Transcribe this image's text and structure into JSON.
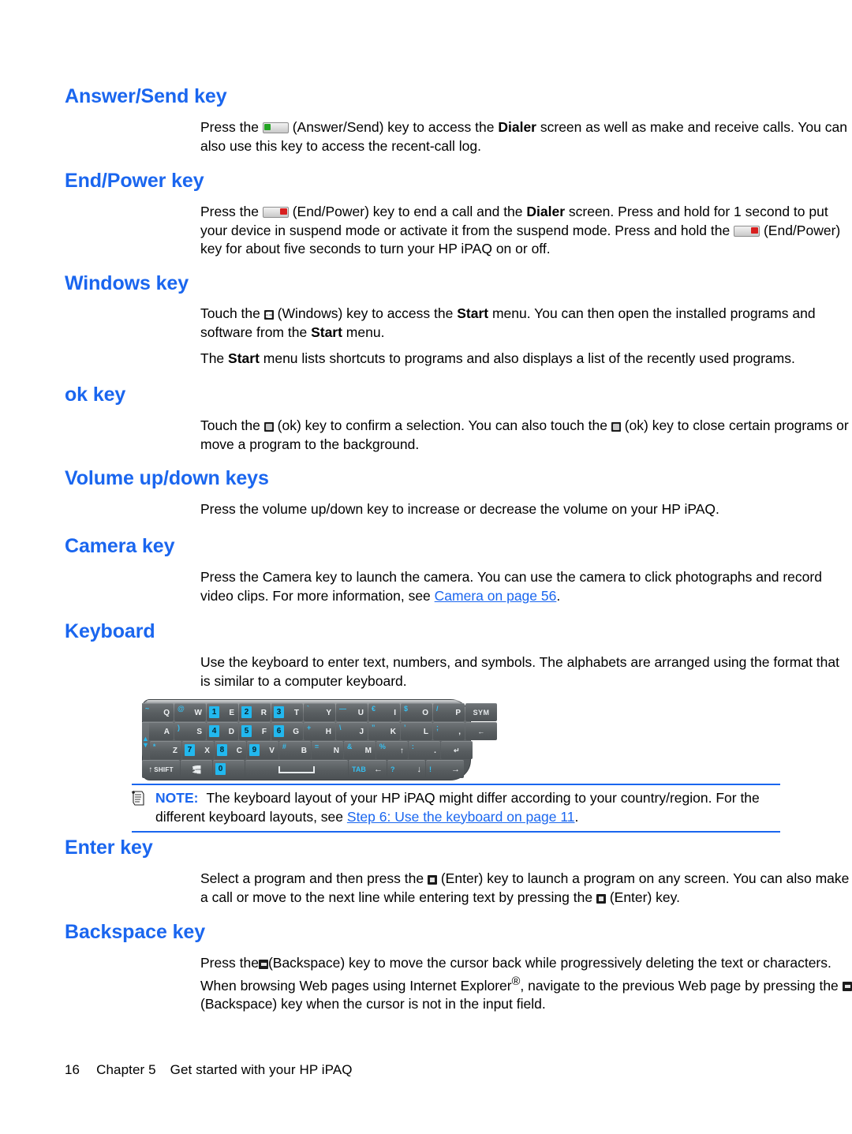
{
  "document": {
    "accent_color": "#1a66ef",
    "link_color": "#1a66ef"
  },
  "sections": [
    {
      "id": "answer-send-key",
      "heading": "Answer/Send key",
      "paragraphs": [
        {
          "lead": "Press the",
          "icon": "answer-send-key-icon",
          "text_a": "(Answer/Send) key to access the ",
          "bold_a": "Dialer",
          "text_b": " screen as well as make and receive calls. You can also use this key to access the recent-call log."
        }
      ]
    },
    {
      "id": "end-power-key",
      "heading": "End/Power key",
      "paragraphs": [
        {
          "lead": "Press the",
          "icon": "end-power-key-icon",
          "text_a": "(End/Power) key to end a call and the ",
          "bold_a": "Dialer",
          "text_b": " screen. Press and hold for 1 second to put your device in suspend mode or activate it from the suspend mode. Press and hold the",
          "icon_b": "end-power-key-icon",
          "text_c": "(End/Power) key for about five seconds to turn your HP iPAQ on or off."
        }
      ]
    },
    {
      "id": "windows-key",
      "heading": "Windows key",
      "paragraphs": [
        {
          "lead": "Touch the",
          "icon": "windows-key-icon",
          "text_a": "(Windows) key to access the ",
          "bold_a": "Start",
          "text_b": " menu. You can then open the installed programs and software from the ",
          "bold_b": "Start",
          "text_c": " menu."
        },
        {
          "lead_plain_a": "The ",
          "bold_a": "Start",
          "text_a": " menu lists shortcuts to programs and also displays a list of the recently used programs."
        }
      ]
    },
    {
      "id": "ok-key",
      "heading": "ok key",
      "paragraphs": [
        {
          "lead": "Touch the",
          "icon": "ok-key-icon",
          "text_a": "(ok) key to confirm a selection. You can also touch the",
          "icon_b": "ok-key-icon",
          "text_b": "(ok) key to close certain programs or move a program to the background."
        }
      ]
    },
    {
      "id": "volume-up-down-keys",
      "heading": "Volume up/down keys",
      "paragraphs": [
        {
          "text_plain": "Press the volume up/down key to increase or decrease the volume on your HP iPAQ."
        }
      ]
    },
    {
      "id": "camera-key",
      "heading": "Camera key",
      "paragraphs": [
        {
          "text_a": "Press the Camera key to launch the camera. You can use the camera to click photographs and record video clips. For more information, see ",
          "link": "Camera on page 56",
          "text_b": "."
        }
      ]
    },
    {
      "id": "keyboard",
      "heading": "Keyboard",
      "paragraphs": [
        {
          "text_plain": "Use the keyboard to enter text, numbers, and symbols. The alphabets are arranged using the format that is similar to a computer keyboard."
        }
      ]
    },
    {
      "id": "enter-key",
      "heading": "Enter key",
      "paragraphs": [
        {
          "lead": "Select a program and then press the",
          "icon": "enter-key-icon",
          "text_a": "(Enter) key to launch a program on any screen. You can also make a call or move to the next line while entering text by pressing the",
          "icon_b": "enter-key-icon",
          "text_b": "(Enter) key."
        }
      ]
    },
    {
      "id": "backspace-key",
      "heading": "Backspace key",
      "paragraphs": [
        {
          "lead": "Press the",
          "icon": "backspace-key-icon",
          "text_a": "(Backspace) key to move the cursor back while progressively deleting the text or characters. When browsing Web pages using Internet Explorer",
          "sup": "®",
          "text_b": ", navigate to the previous Web page by pressing the",
          "icon_b": "backspace-key-icon",
          "text_c": "(Backspace) key when the cursor is not in the input field."
        }
      ]
    }
  ],
  "note": {
    "icon": "note-icon",
    "label": "NOTE:",
    "text_a": "The keyboard layout of your HP iPAQ might differ according to your country/region. For the different keyboard layouts, see ",
    "link": "Step 6: Use the keyboard on page 11",
    "text_b": "."
  },
  "keyboard_figure": {
    "name": "hp-ipaq-qwerty-keyboard-diagram",
    "rows": [
      {
        "keys": [
          {
            "type": "letter",
            "sub": "~",
            "main": "Q",
            "clipped": true
          },
          {
            "type": "letter",
            "sub": "@",
            "main": "W"
          },
          {
            "type": "numkey",
            "num": "1",
            "main": "E"
          },
          {
            "type": "numkey",
            "num": "2",
            "main": "R"
          },
          {
            "type": "numkey",
            "num": "3",
            "main": "T"
          },
          {
            "type": "letter",
            "sub": "`",
            "main": "Y"
          },
          {
            "type": "letter",
            "sub": "—",
            "main": "U"
          },
          {
            "type": "letter",
            "sub": "€",
            "main": "I"
          },
          {
            "type": "letter",
            "sub": "$",
            "main": "O"
          },
          {
            "type": "letter",
            "sub": "/",
            "main": "P"
          },
          {
            "type": "special",
            "main": "SYM"
          }
        ]
      },
      {
        "keys": [
          {
            "type": "letter",
            "sub": "(",
            "main": "A",
            "clipped": true
          },
          {
            "type": "letter",
            "sub": ")",
            "main": "S"
          },
          {
            "type": "numkey",
            "num": "4",
            "main": "D"
          },
          {
            "type": "numkey",
            "num": "5",
            "main": "F"
          },
          {
            "type": "numkey",
            "num": "6",
            "main": "G"
          },
          {
            "type": "letter",
            "sub": "+",
            "main": "H"
          },
          {
            "type": "letter",
            "sub": "\\",
            "main": "J"
          },
          {
            "type": "letter",
            "sub": "”",
            "main": "K"
          },
          {
            "type": "letter",
            "sub": "’",
            "main": "L"
          },
          {
            "type": "letter",
            "sub": ";",
            "main": ","
          },
          {
            "type": "special",
            "main": "←"
          }
        ]
      },
      {
        "keys": [
          {
            "type": "nav",
            "main": "▲▼"
          },
          {
            "type": "letter",
            "sub": "*",
            "main": "Z"
          },
          {
            "type": "numkey",
            "num": "7",
            "main": "X"
          },
          {
            "type": "numkey",
            "num": "8",
            "main": "C"
          },
          {
            "type": "numkey",
            "num": "9",
            "main": "V"
          },
          {
            "type": "letter",
            "sub": "#",
            "main": "B"
          },
          {
            "type": "letter",
            "sub": "=",
            "main": "N"
          },
          {
            "type": "letter",
            "sub": "&",
            "main": "M"
          },
          {
            "type": "letter",
            "sub": "%",
            "main": "↑"
          },
          {
            "type": "letter",
            "sub": ":",
            "main": "."
          },
          {
            "type": "special",
            "main": "↵"
          }
        ]
      },
      {
        "keys": [
          {
            "type": "shift",
            "main": "SHIFT"
          },
          {
            "type": "winkey",
            "main": ""
          },
          {
            "type": "numkey",
            "num": "0",
            "main": ""
          },
          {
            "type": "space",
            "main": ""
          },
          {
            "type": "dual",
            "sub": "TAB",
            "main": "←"
          },
          {
            "type": "dual",
            "sub": "?",
            "main": "↓"
          },
          {
            "type": "dual",
            "sub": "!",
            "main": "→"
          }
        ]
      }
    ]
  },
  "footer": {
    "page_number": "16",
    "chapter": "Chapter 5",
    "chapter_title": "Get started with your HP iPAQ"
  }
}
